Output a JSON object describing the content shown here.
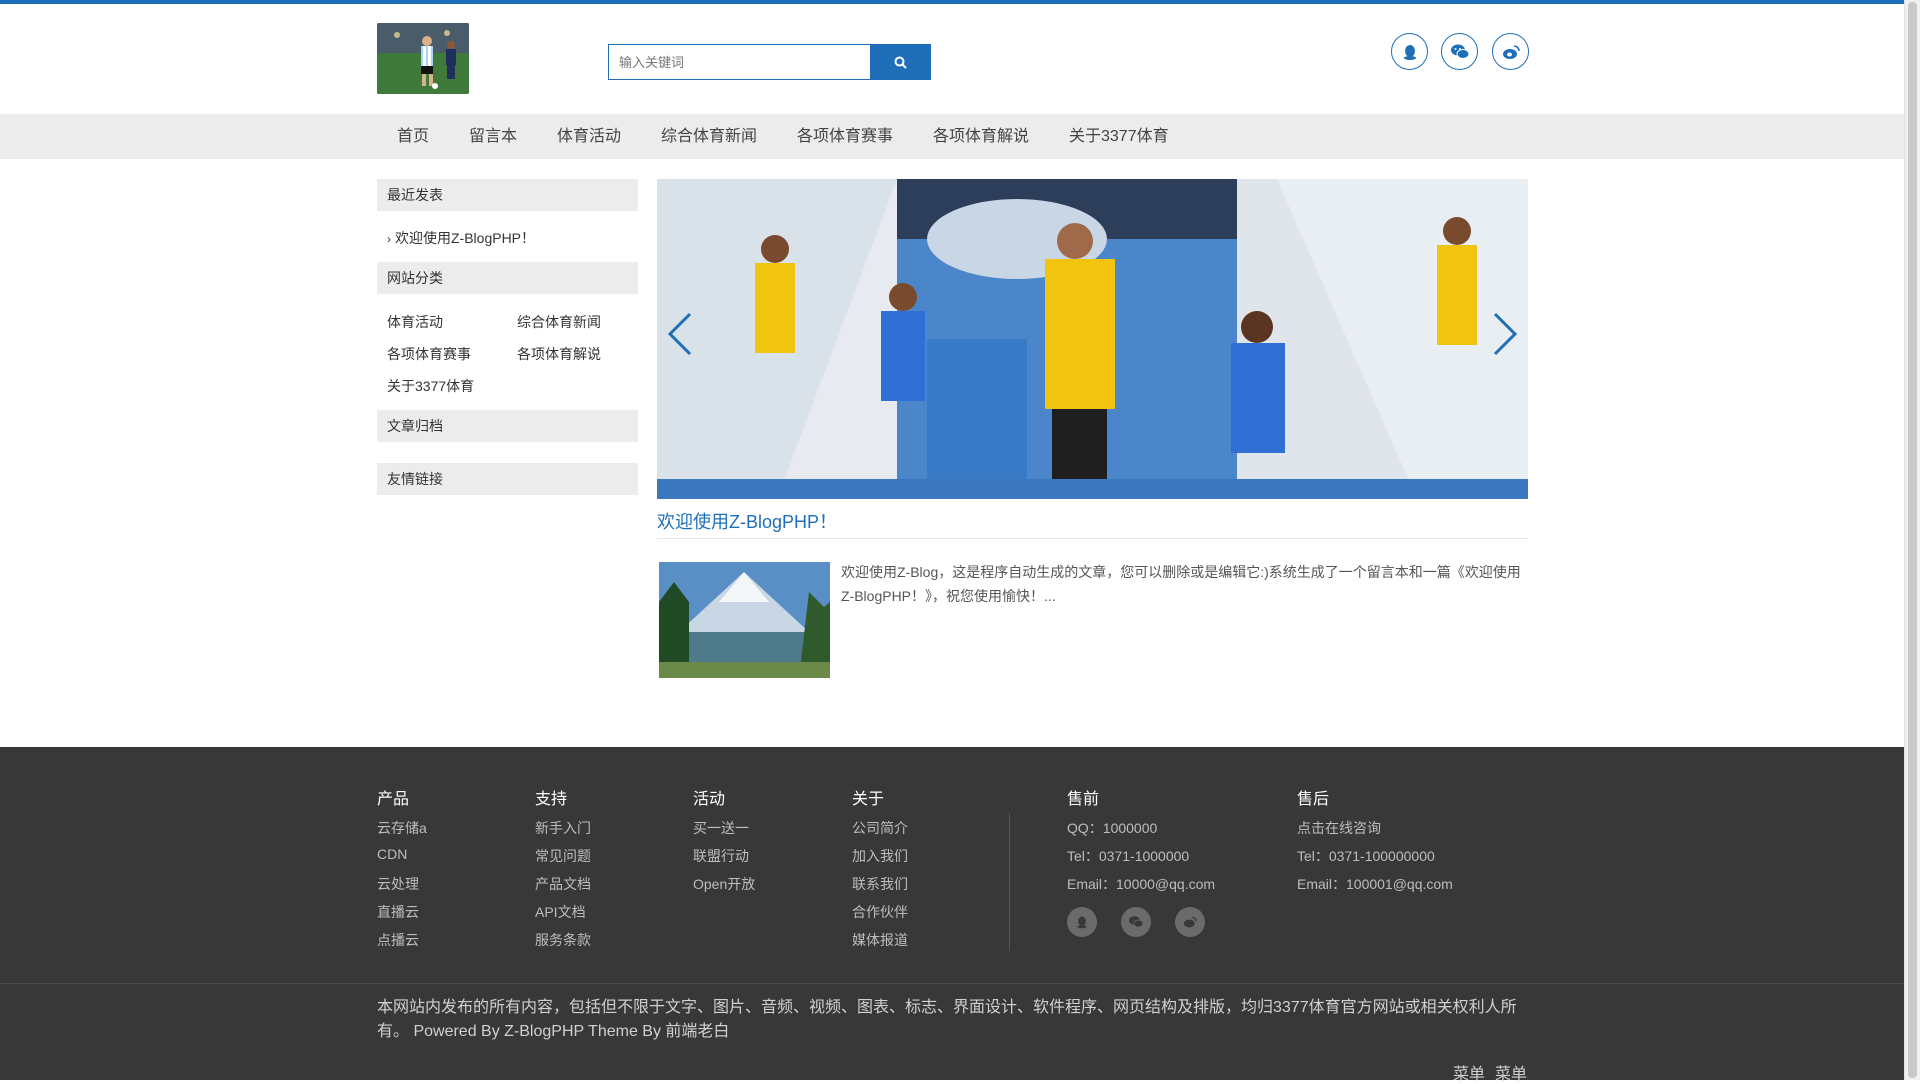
{
  "header": {
    "search_placeholder": "输入关键词",
    "icons": [
      "qq-icon",
      "wechat-icon",
      "weibo-icon"
    ]
  },
  "nav": {
    "items": [
      "首页",
      "留言本",
      "体育活动",
      "综合体育新闻",
      "各项体育赛事",
      "各项体育解说",
      "关于3377体育"
    ]
  },
  "sidebar": {
    "recent_title": "最近发表",
    "recent_items": [
      "欢迎使用Z-BlogPHP！"
    ],
    "categories_title": "网站分类",
    "categories": [
      "体育活动",
      "综合体育新闻",
      "各项体育赛事",
      "各项体育解说",
      "关于3377体育"
    ],
    "archive_title": "文章归档",
    "links_title": "友情链接"
  },
  "post": {
    "title": "欢迎使用Z-BlogPHP！",
    "excerpt": "欢迎使用Z-Blog，这是程序自动生成的文章，您可以删除或是编辑它:)系统生成了一个留言本和一篇《欢迎使用Z-BlogPHP！》，祝您使用愉快！..."
  },
  "footer": {
    "columns": [
      {
        "title": "产品",
        "links": [
          "云存储a",
          "CDN",
          "云处理",
          "直播云",
          "点播云"
        ]
      },
      {
        "title": "支持",
        "links": [
          "新手入门",
          "常见问题",
          "产品文档",
          "API文档",
          "服务条款"
        ]
      },
      {
        "title": "活动",
        "links": [
          "买一送一",
          "联盟行动",
          "Open开放"
        ]
      },
      {
        "title": "关于",
        "links": [
          "公司简介",
          "加入我们",
          "联系我们",
          "合作伙伴",
          "媒体报道"
        ]
      }
    ],
    "presale": {
      "title": "售前",
      "lines": [
        "QQ：1000000",
        "Tel：0371-1000000",
        "Email：10000@qq.com"
      ]
    },
    "aftersale": {
      "title": "售后",
      "lines": [
        "点击在线咨询",
        "Tel：0371-100000000",
        "Email：100001@qq.com"
      ]
    },
    "copyright": "本网站内发布的所有内容，包括但不限于文字、图片、音频、视频、图表、标志、界面设计、软件程序、网页结构及排版，均归3377体育官方网站或相关权利人所有。 Powered By Z-BlogPHP Theme By 前端老白",
    "bottom_menu": [
      "菜单",
      "菜单"
    ]
  },
  "colors": {
    "accent": "#1e6fb8",
    "nav_bg": "#ececec",
    "footer_bg": "#383838"
  }
}
